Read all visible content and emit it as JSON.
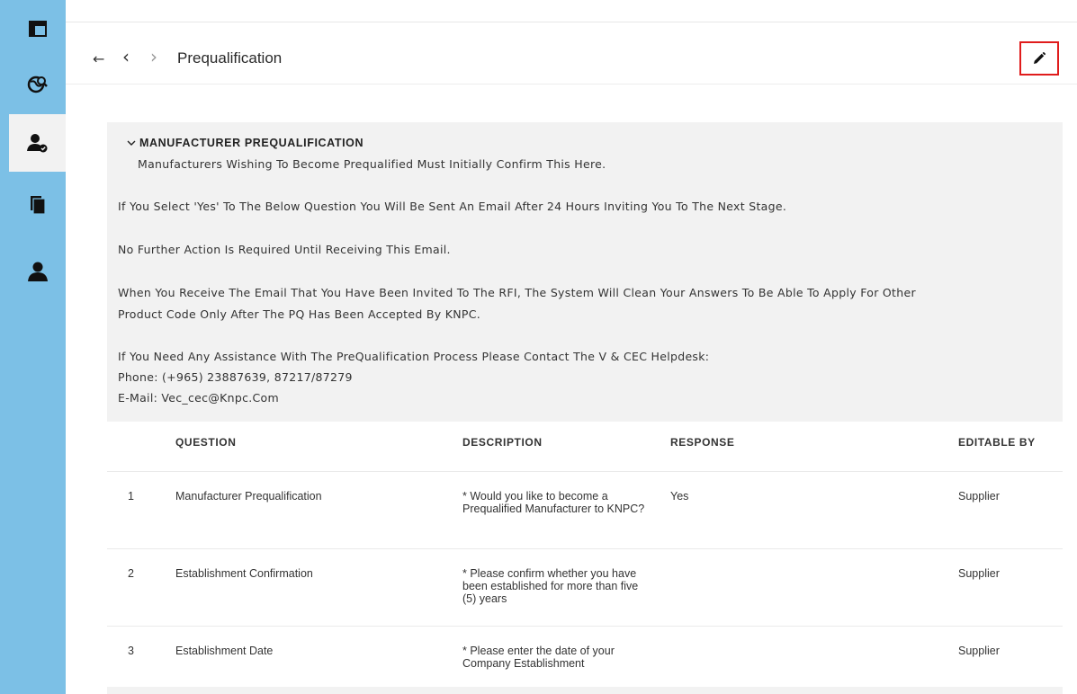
{
  "sidebar": {
    "items": [
      {
        "icon": "layout-icon"
      },
      {
        "icon": "globe-search-icon"
      },
      {
        "icon": "user-check-icon",
        "active": true
      },
      {
        "icon": "documents-icon"
      },
      {
        "icon": "user-icon"
      }
    ]
  },
  "header": {
    "back_arrow": "←",
    "prev": "‹",
    "next": "›",
    "title": "Prequalification"
  },
  "section": {
    "title": "MANUFACTURER PREQUALIFICATION",
    "subtitle": "Manufacturers Wishing To Become Prequalified Must Initially Confirm This Here.",
    "line1": "If You Select 'Yes' To The Below Question You Will Be Sent An Email After 24 Hours Inviting You To The Next Stage.",
    "line2": "No Further Action Is Required Until Receiving This Email.",
    "line3a": "When You Receive The Email That You Have Been Invited To The RFI, The System Will Clean Your Answers To Be Able To Apply For Other",
    "line3b": "Product Code Only After The PQ Has Been Accepted By KNPC.",
    "line4": "If You Need Any Assistance With The PreQualification Process Please Contact The V & CEC Helpdesk:",
    "phone": "Phone: (+965) 23887639, 87217/87279",
    "email": "E-Mail: Vec_cec@Knpc.Com"
  },
  "table": {
    "headers": {
      "question": "QUESTION",
      "description": "DESCRIPTION",
      "response": "RESPONSE",
      "editable_by": "EDITABLE BY"
    },
    "rows": [
      {
        "num": "1",
        "question": "Manufacturer Prequalification",
        "description": "* Would you like to become a Prequalified Manufacturer to KNPC?",
        "response": "Yes",
        "editable_by": "Supplier"
      },
      {
        "num": "2",
        "question": "Establishment Confirmation",
        "description": "* Please confirm whether you have been established for more than five (5) years",
        "response": "",
        "editable_by": "Supplier"
      },
      {
        "num": "3",
        "question": "Establishment Date",
        "description": "* Please enter the date of your Company Establishment",
        "response": "",
        "editable_by": "Supplier"
      }
    ]
  },
  "colors": {
    "sidebar": "#7cc0e6",
    "panel": "#f2f2f2",
    "highlight": "#e01c1c"
  }
}
